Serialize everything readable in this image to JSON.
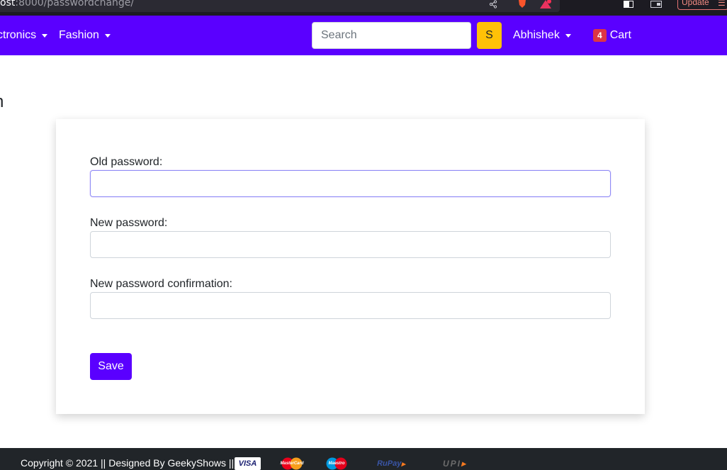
{
  "browser": {
    "url_prefix": "ost",
    "url_rest": ":8000/passwordchange/",
    "update_label": "Update"
  },
  "navbar": {
    "items": [
      {
        "label": "ctronics"
      },
      {
        "label": "Fashion"
      }
    ],
    "search_placeholder": "Search",
    "search_button_label": "S",
    "user_label": "Abhishek",
    "cart_count": "4",
    "cart_label": "Cart",
    "accent_color": "#5a00ff"
  },
  "page": {
    "heading_fragment": "n"
  },
  "form": {
    "fields": [
      {
        "label": "Old password:",
        "value": ""
      },
      {
        "label": "New password:",
        "value": ""
      },
      {
        "label": "New password confirmation:",
        "value": ""
      }
    ],
    "save_label": "Save"
  },
  "footer": {
    "text": "Copyright © 2021 || Designed By GeekyShows ||",
    "payment_logos": [
      {
        "label": "VISA",
        "icon": "visa-icon"
      },
      {
        "label": "MasterCard",
        "icon": "mastercard-icon"
      },
      {
        "label": "Maestro",
        "icon": "maestro-icon"
      },
      {
        "label": "RuPay",
        "icon": "rupay-icon"
      },
      {
        "label": "UPI",
        "icon": "upi-icon"
      }
    ]
  }
}
